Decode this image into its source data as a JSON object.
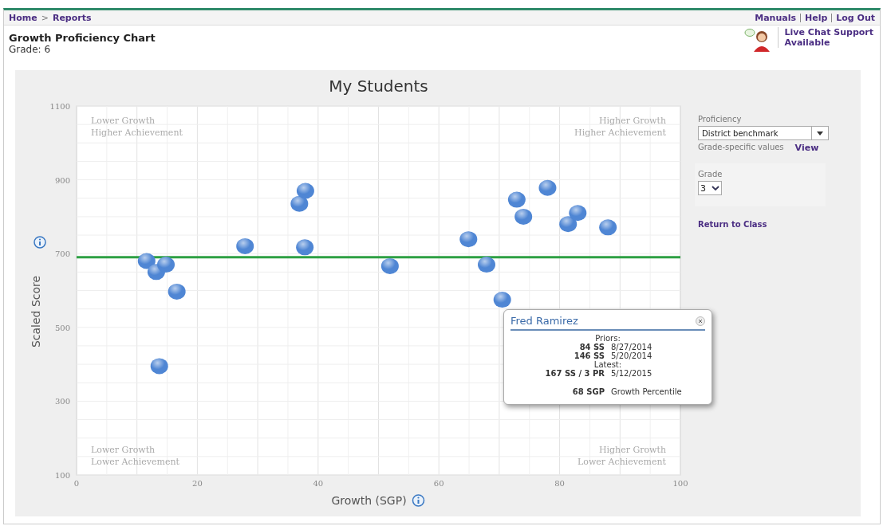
{
  "breadcrumb": [
    {
      "label": "Home"
    },
    {
      "label": "Reports"
    }
  ],
  "breadcrumb_separator": ">",
  "top_links": [
    {
      "label": "Manuals"
    },
    {
      "label": "Help"
    },
    {
      "label": "Log Out"
    }
  ],
  "header": {
    "title": "Growth Proficiency Chart",
    "subtitle": "Grade: 6"
  },
  "live_chat": {
    "title": "Live Chat Support",
    "status": "Available"
  },
  "chart": {
    "chart_data": {
      "type": "scatter",
      "title": "My Students",
      "xlabel": "Growth (SGP)",
      "ylabel": "Scaled Score",
      "xlim": [
        0,
        100
      ],
      "ylim": [
        100,
        1100
      ],
      "xticks": [
        0,
        20,
        40,
        60,
        80,
        100
      ],
      "yticks": [
        100,
        300,
        500,
        700,
        900,
        1100
      ],
      "x": [
        11.6,
        13.2,
        14.8,
        16.6,
        13.7,
        27.9,
        36.9,
        37.9,
        37.8,
        51.9,
        64.9,
        67.9,
        70.5,
        72.9,
        74,
        78,
        81.4,
        83,
        88
      ],
      "values": [
        680,
        650,
        670,
        597,
        395,
        720,
        835,
        870,
        717,
        666,
        739,
        670,
        575,
        846,
        800,
        878,
        780,
        810,
        771
      ],
      "grid": true,
      "ref_lines": [
        {
          "axis": "y",
          "value": 690,
          "color": "#2ea043"
        }
      ]
    },
    "quadrant_labels": [
      {
        "lines": [
          "Lower Growth",
          "Higher Achievement"
        ]
      },
      {
        "lines": [
          "Higher Growth",
          "Higher Achievement"
        ]
      },
      {
        "lines": [
          "Lower Growth",
          "Lower Achievement"
        ]
      },
      {
        "lines": [
          "Higher Growth",
          "Lower Achievement"
        ]
      }
    ]
  },
  "tooltip": {
    "name": "Fred Ramirez",
    "sections": [
      {
        "kind": "heading",
        "text": "Priors:"
      },
      {
        "kind": "row",
        "value": "84 SS",
        "note": "8/27/2014"
      },
      {
        "kind": "row",
        "value": "146 SS",
        "note": "5/20/2014"
      },
      {
        "kind": "heading",
        "text": "Latest:"
      },
      {
        "kind": "row",
        "value": "167 SS / 3 PR",
        "note": "5/12/2015"
      },
      {
        "kind": "gap"
      },
      {
        "kind": "row",
        "value": "68 SGP",
        "note": "Growth Percentile"
      }
    ]
  },
  "sidebar": {
    "proficiency_label": "Proficiency",
    "proficiency_value": "District benchmark",
    "hint": "Grade-specific values",
    "view_link": "View",
    "grade_label": "Grade",
    "grade_value": "3",
    "return_link": "Return to Class"
  }
}
